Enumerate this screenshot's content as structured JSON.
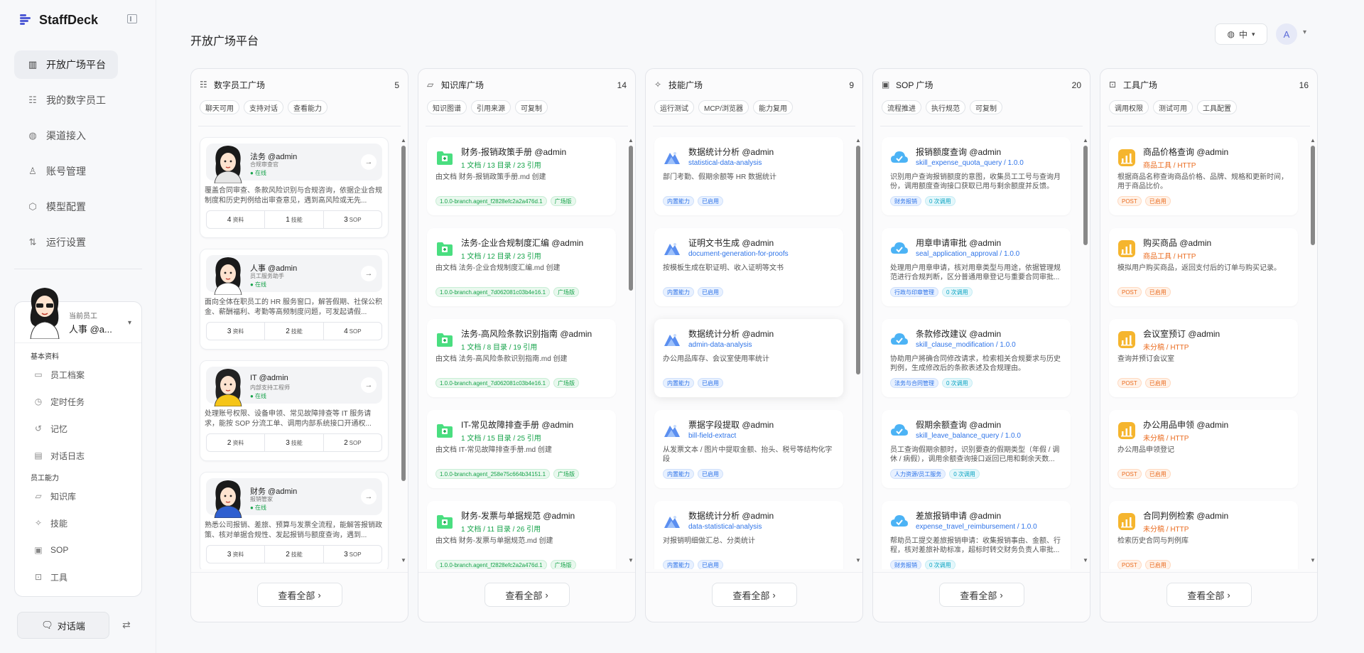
{
  "app": {
    "title": "StaffDeck"
  },
  "nav": [
    {
      "label": "开放广场平台",
      "icon": "building-icon",
      "active": true
    },
    {
      "label": "我的数字员工",
      "icon": "users-icon",
      "active": false
    },
    {
      "label": "渠道接入",
      "icon": "globe-icon",
      "active": false
    },
    {
      "label": "账号管理",
      "icon": "user-icon",
      "active": false
    },
    {
      "label": "模型配置",
      "icon": "cube-icon",
      "active": false
    },
    {
      "label": "运行设置",
      "icon": "swap-vertical-icon",
      "active": false
    }
  ],
  "employee_panel": {
    "current_label": "当前员工",
    "current_name": "人事 @a...",
    "section_basic": "基本资料",
    "basic_items": [
      {
        "label": "员工档案",
        "icon": "id-card-icon"
      },
      {
        "label": "定时任务",
        "icon": "clock-icon"
      },
      {
        "label": "记忆",
        "icon": "history-icon"
      },
      {
        "label": "对话日志",
        "icon": "calendar-icon"
      }
    ],
    "section_ability": "员工能力",
    "ability_items": [
      {
        "label": "知识库",
        "icon": "folder-icon"
      },
      {
        "label": "技能",
        "icon": "sparkle-icon"
      },
      {
        "label": "SOP",
        "icon": "clipboard-icon"
      },
      {
        "label": "工具",
        "icon": "briefcase-icon"
      }
    ]
  },
  "chat_button": {
    "label": "对话端"
  },
  "page_title": "开放广场平台",
  "lang_label": "中",
  "avatar_letter": "A",
  "view_all_label": "查看全部",
  "employees": {
    "title": "数字员工广场",
    "count": "5",
    "tags": [
      "聊天可用",
      "支持对话",
      "查看能力"
    ],
    "cards": [
      {
        "name": "法务 @admin",
        "role": "合规审查官",
        "status": "● 在线",
        "desc": "覆盖合同审查、条款风险识别与合规咨询，依据企业合规制度和历史判例给出审查意见，遇到高风险或无先...",
        "s1": "4",
        "s1l": "资料",
        "s2": "1",
        "s2l": "技能",
        "s3": "3",
        "s3l": "SOP"
      },
      {
        "name": "人事 @admin",
        "role": "员工服务助手",
        "status": "● 在线",
        "desc": "面向全体在职员工的 HR 服务窗口，解答假期、社保公积金、薪酬福利、考勤等高频制度问题，可发起请假...",
        "s1": "3",
        "s1l": "资料",
        "s2": "2",
        "s2l": "技能",
        "s3": "4",
        "s3l": "SOP"
      },
      {
        "name": "IT @admin",
        "role": "内部支持工程师",
        "status": "● 在线",
        "desc": "处理账号权限、设备申领、常见故障排查等 IT 服务请求，能按 SOP 分流工单、调用内部系统接口开通权...",
        "s1": "2",
        "s1l": "资料",
        "s2": "3",
        "s2l": "技能",
        "s3": "2",
        "s3l": "SOP"
      },
      {
        "name": "财务 @admin",
        "role": "报销管家",
        "status": "● 在线",
        "desc": "熟悉公司报销、差旅、预算与发票全流程，能解答报销政策、核对单据合规性、发起报销与额度查询，遇到...",
        "s1": "3",
        "s1l": "资料",
        "s2": "2",
        "s2l": "技能",
        "s3": "3",
        "s3l": "SOP"
      }
    ]
  },
  "knowledge": {
    "title": "知识库广场",
    "count": "14",
    "tags": [
      "知识图谱",
      "引用来源",
      "可复制"
    ],
    "cards": [
      {
        "title": "财务-报销政策手册 @admin",
        "meta": "1 文档 / 13 目录 / 23 引用",
        "desc": "由文档 财务-报销政策手册.md 创建",
        "b1": "1.0.0-branch.agent_f2828efc2a2a476d.1",
        "b2": "广场版"
      },
      {
        "title": "法务-企业合规制度汇编 @admin",
        "meta": "1 文档 / 12 目录 / 23 引用",
        "desc": "由文档 法务-企业合规制度汇编.md 创建",
        "b1": "1.0.0-branch.agent_7d062081c03b4e16.1",
        "b2": "广场版"
      },
      {
        "title": "法务-高风险条款识别指南 @admin",
        "meta": "1 文档 / 8 目录 / 19 引用",
        "desc": "由文档 法务-高风险条款识别指南.md 创建",
        "b1": "1.0.0-branch.agent_7d062081c03b4e16.1",
        "b2": "广场版"
      },
      {
        "title": "IT-常见故障排查手册 @admin",
        "meta": "1 文档 / 15 目录 / 25 引用",
        "desc": "由文档 IT-常见故障排查手册.md 创建",
        "b1": "1.0.0-branch.agent_258e75c664b34151.1",
        "b2": "广场版"
      },
      {
        "title": "财务-发票与单据规范 @admin",
        "meta": "1 文档 / 11 目录 / 26 引用",
        "desc": "由文档 财务-发票与单据规范.md 创建",
        "b1": "1.0.0-branch.agent_f2828efc2a2a476d.1",
        "b2": "广场版"
      }
    ]
  },
  "skills": {
    "title": "技能广场",
    "count": "9",
    "tags": [
      "运行测试",
      "MCP/浏览器",
      "能力复用"
    ],
    "cards": [
      {
        "title": "数据统计分析 @admin",
        "meta": "statistical-data-analysis",
        "desc": "部门考勤、假期余额等 HR 数据统计",
        "b1": "内置能力",
        "b2": "已启用"
      },
      {
        "title": "证明文书生成 @admin",
        "meta": "document-generation-for-proofs",
        "desc": "按模板生成在职证明、收入证明等文书",
        "b1": "内置能力",
        "b2": "已启用"
      },
      {
        "title": "数据统计分析 @admin",
        "meta": "admin-data-analysis",
        "desc": "办公用品库存、会议室使用率统计",
        "b1": "内置能力",
        "b2": "已启用"
      },
      {
        "title": "票据字段提取 @admin",
        "meta": "bill-field-extract",
        "desc": "从发票文本 / 图片中提取金额、抬头、税号等结构化字段",
        "b1": "内置能力",
        "b2": "已启用"
      },
      {
        "title": "数据统计分析 @admin",
        "meta": "data-statistical-analysis",
        "desc": "对报销明细做汇总、分类统计",
        "b1": "内置能力",
        "b2": "已启用"
      }
    ]
  },
  "sops": {
    "title": "SOP 广场",
    "count": "20",
    "tags": [
      "流程推进",
      "执行规范",
      "可复制"
    ],
    "cards": [
      {
        "title": "报销额度查询 @admin",
        "meta": "skill_expense_quota_query / 1.0.0",
        "desc": "识别用户查询报销额度的意图，收集员工工号与查询月份，调用额度查询接口获取已用与剩余额度并反馈。",
        "b1": "财务报销",
        "b2": "0 次调用"
      },
      {
        "title": "用章申请审批 @admin",
        "meta": "seal_application_approval / 1.0.0",
        "desc": "处理用户用章申请，核对用章类型与用途，依据管理规范进行合规判断，区分普通用章登记与重要合同审批...",
        "b1": "行政与印章管理",
        "b2": "0 次调用"
      },
      {
        "title": "条款修改建议 @admin",
        "meta": "skill_clause_modification / 1.0.0",
        "desc": "协助用户將确合同修改请求，检索相关合规要求与历史判例，生成修改后的条款表述及合规理由。",
        "b1": "法务与合同管理",
        "b2": "0 次调用"
      },
      {
        "title": "假期余额查询 @admin",
        "meta": "skill_leave_balance_query / 1.0.0",
        "desc": "员工查询假期余额时，识别要查的假期类型（年假 / 调休 / 病假），调用余额查询接口返回已用和剩余天数...",
        "b1": "人力资源/员工服务",
        "b2": "0 次调用"
      },
      {
        "title": "差旅报销申请 @admin",
        "meta": "expense_travel_reimbursement / 1.0.0",
        "desc": "帮助员工提交差旅报销申请：收集报销事由、金额、行程，核对差旅补助标准，超标时转交财务负责人审批...",
        "b1": "财务报销",
        "b2": "0 次调用"
      }
    ]
  },
  "tools": {
    "title": "工具广场",
    "count": "16",
    "tags": [
      "调用权限",
      "测试可用",
      "工具配置"
    ],
    "cards": [
      {
        "title": "商品价格查询 @admin",
        "meta": "商品工具 / HTTP",
        "desc": "根据商品名称查询商品价格、品牌、规格和更新时间，用于商品比价。",
        "b1": "POST",
        "b2": "已启用"
      },
      {
        "title": "购买商品 @admin",
        "meta": "商品工具 / HTTP",
        "desc": "模拟用户购买商品，返回支付后的订单与购买记录。",
        "b1": "POST",
        "b2": "已启用"
      },
      {
        "title": "会议室预订 @admin",
        "meta": "未分稿 / HTTP",
        "desc": "查询并预订会议室",
        "b1": "POST",
        "b2": "已启用"
      },
      {
        "title": "办公用品申领 @admin",
        "meta": "未分稿 / HTTP",
        "desc": "办公用品申领登记",
        "b1": "POST",
        "b2": "已启用"
      },
      {
        "title": "合同判例检索 @admin",
        "meta": "未分稿 / HTTP",
        "desc": "检索历史合同与判例库",
        "b1": "POST",
        "b2": "已启用"
      }
    ]
  }
}
